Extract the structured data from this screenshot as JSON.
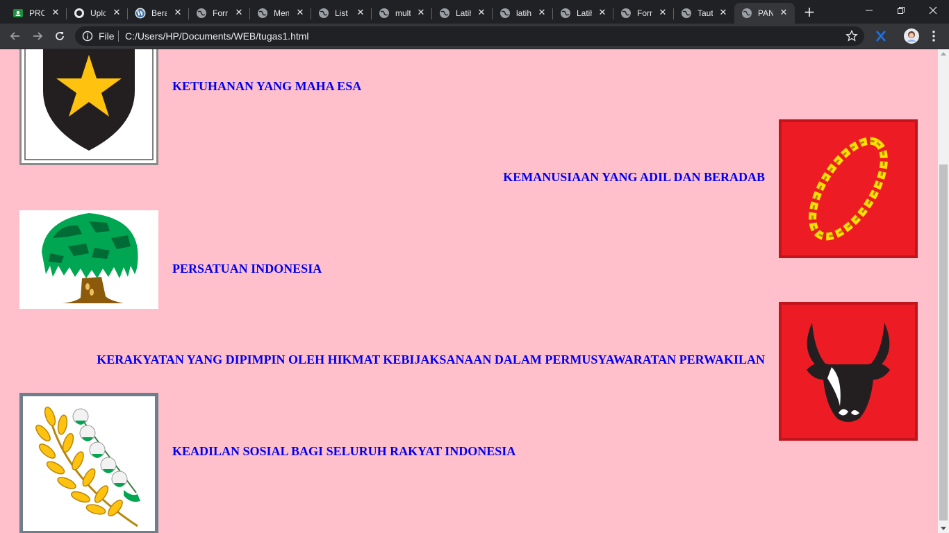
{
  "browser": {
    "tabs": [
      {
        "title": "PRO",
        "icon": "classroom-icon"
      },
      {
        "title": "Uplo",
        "icon": "github-icon"
      },
      {
        "title": "Bera",
        "icon": "wordpress-icon"
      },
      {
        "title": "Forn",
        "icon": "globe-icon"
      },
      {
        "title": "Men",
        "icon": "globe-icon"
      },
      {
        "title": "List p",
        "icon": "globe-icon"
      },
      {
        "title": "mult",
        "icon": "globe-icon"
      },
      {
        "title": "Latih",
        "icon": "globe-icon"
      },
      {
        "title": "latih",
        "icon": "globe-icon"
      },
      {
        "title": "Latih",
        "icon": "globe-icon"
      },
      {
        "title": "Forn",
        "icon": "globe-icon"
      },
      {
        "title": "Taut",
        "icon": "globe-icon"
      },
      {
        "title": "PAN",
        "icon": "globe-icon",
        "active": true
      }
    ],
    "new_tab_label": "+",
    "scheme_label": "File",
    "url": "C:/Users/HP/Documents/WEB/tugas1.html"
  },
  "colors": {
    "page_background": "#ffc0cb",
    "sila_text": "#0000ee",
    "red_field": "#ed1c24",
    "star_gold": "#ffc20e"
  },
  "sila": [
    {
      "text": "KETUHANAN YANG MAHA ESA",
      "emblem": "star-emblem"
    },
    {
      "text": "KEMANUSIAAN YANG ADIL DAN BERADAB",
      "emblem": "chain-emblem"
    },
    {
      "text": "PERSATUAN INDONESIA",
      "emblem": "banyan-tree-emblem"
    },
    {
      "text": "KERAKYATAN YANG DIPIMPIN OLEH HIKMAT KEBIJAKSANAAN DALAM PERMUSYAWARATAN PERWAKILAN",
      "emblem": "bull-head-emblem"
    },
    {
      "text": "KEADILAN SOSIAL BAGI SELURUH RAKYAT INDONESIA",
      "emblem": "rice-cotton-emblem"
    }
  ]
}
